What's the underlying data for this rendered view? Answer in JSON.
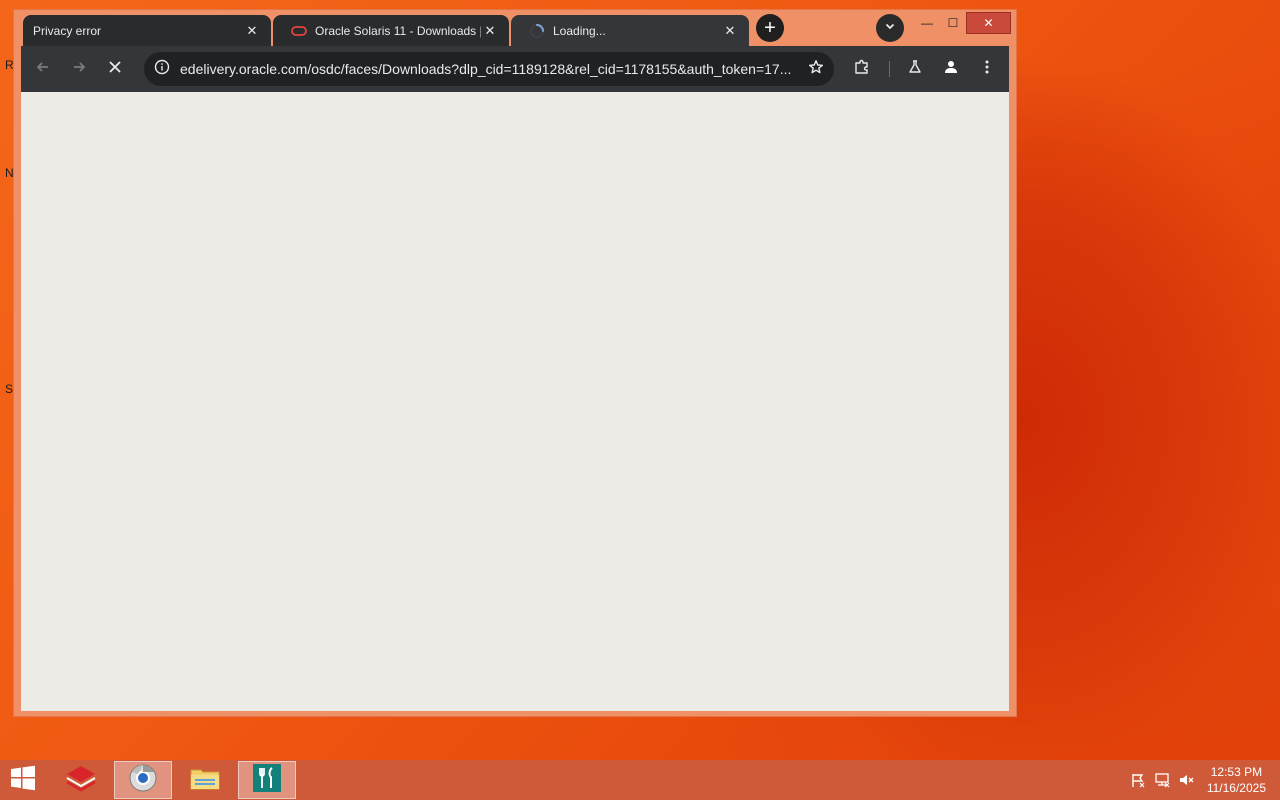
{
  "desktop": {
    "letters": [
      "R",
      "N",
      "S"
    ]
  },
  "browser": {
    "tabs": [
      {
        "title": "Privacy error",
        "close": "✕"
      },
      {
        "title": "Oracle Solaris 11 - Downloads |",
        "close": "✕"
      },
      {
        "title": "Loading...",
        "close": "✕"
      }
    ],
    "new_tab": "+",
    "window_controls": {
      "minimize": "—",
      "maximize": "☐",
      "close": "✕"
    },
    "omnibox": {
      "url": "edelivery.oracle.com/osdc/faces/Downloads?dlp_cid=1189128&rel_cid=1178155&auth_token=17..."
    }
  },
  "taskbar": {
    "clock": {
      "time": "12:53 PM",
      "date": "11/16/2025"
    }
  },
  "colors": {
    "tab_bg": "#2a2b2d",
    "toolbar_bg": "#35363a",
    "omnibox_bg": "#202124",
    "content_bg": "#ecebe6",
    "oracle_red": "#e2453d"
  }
}
